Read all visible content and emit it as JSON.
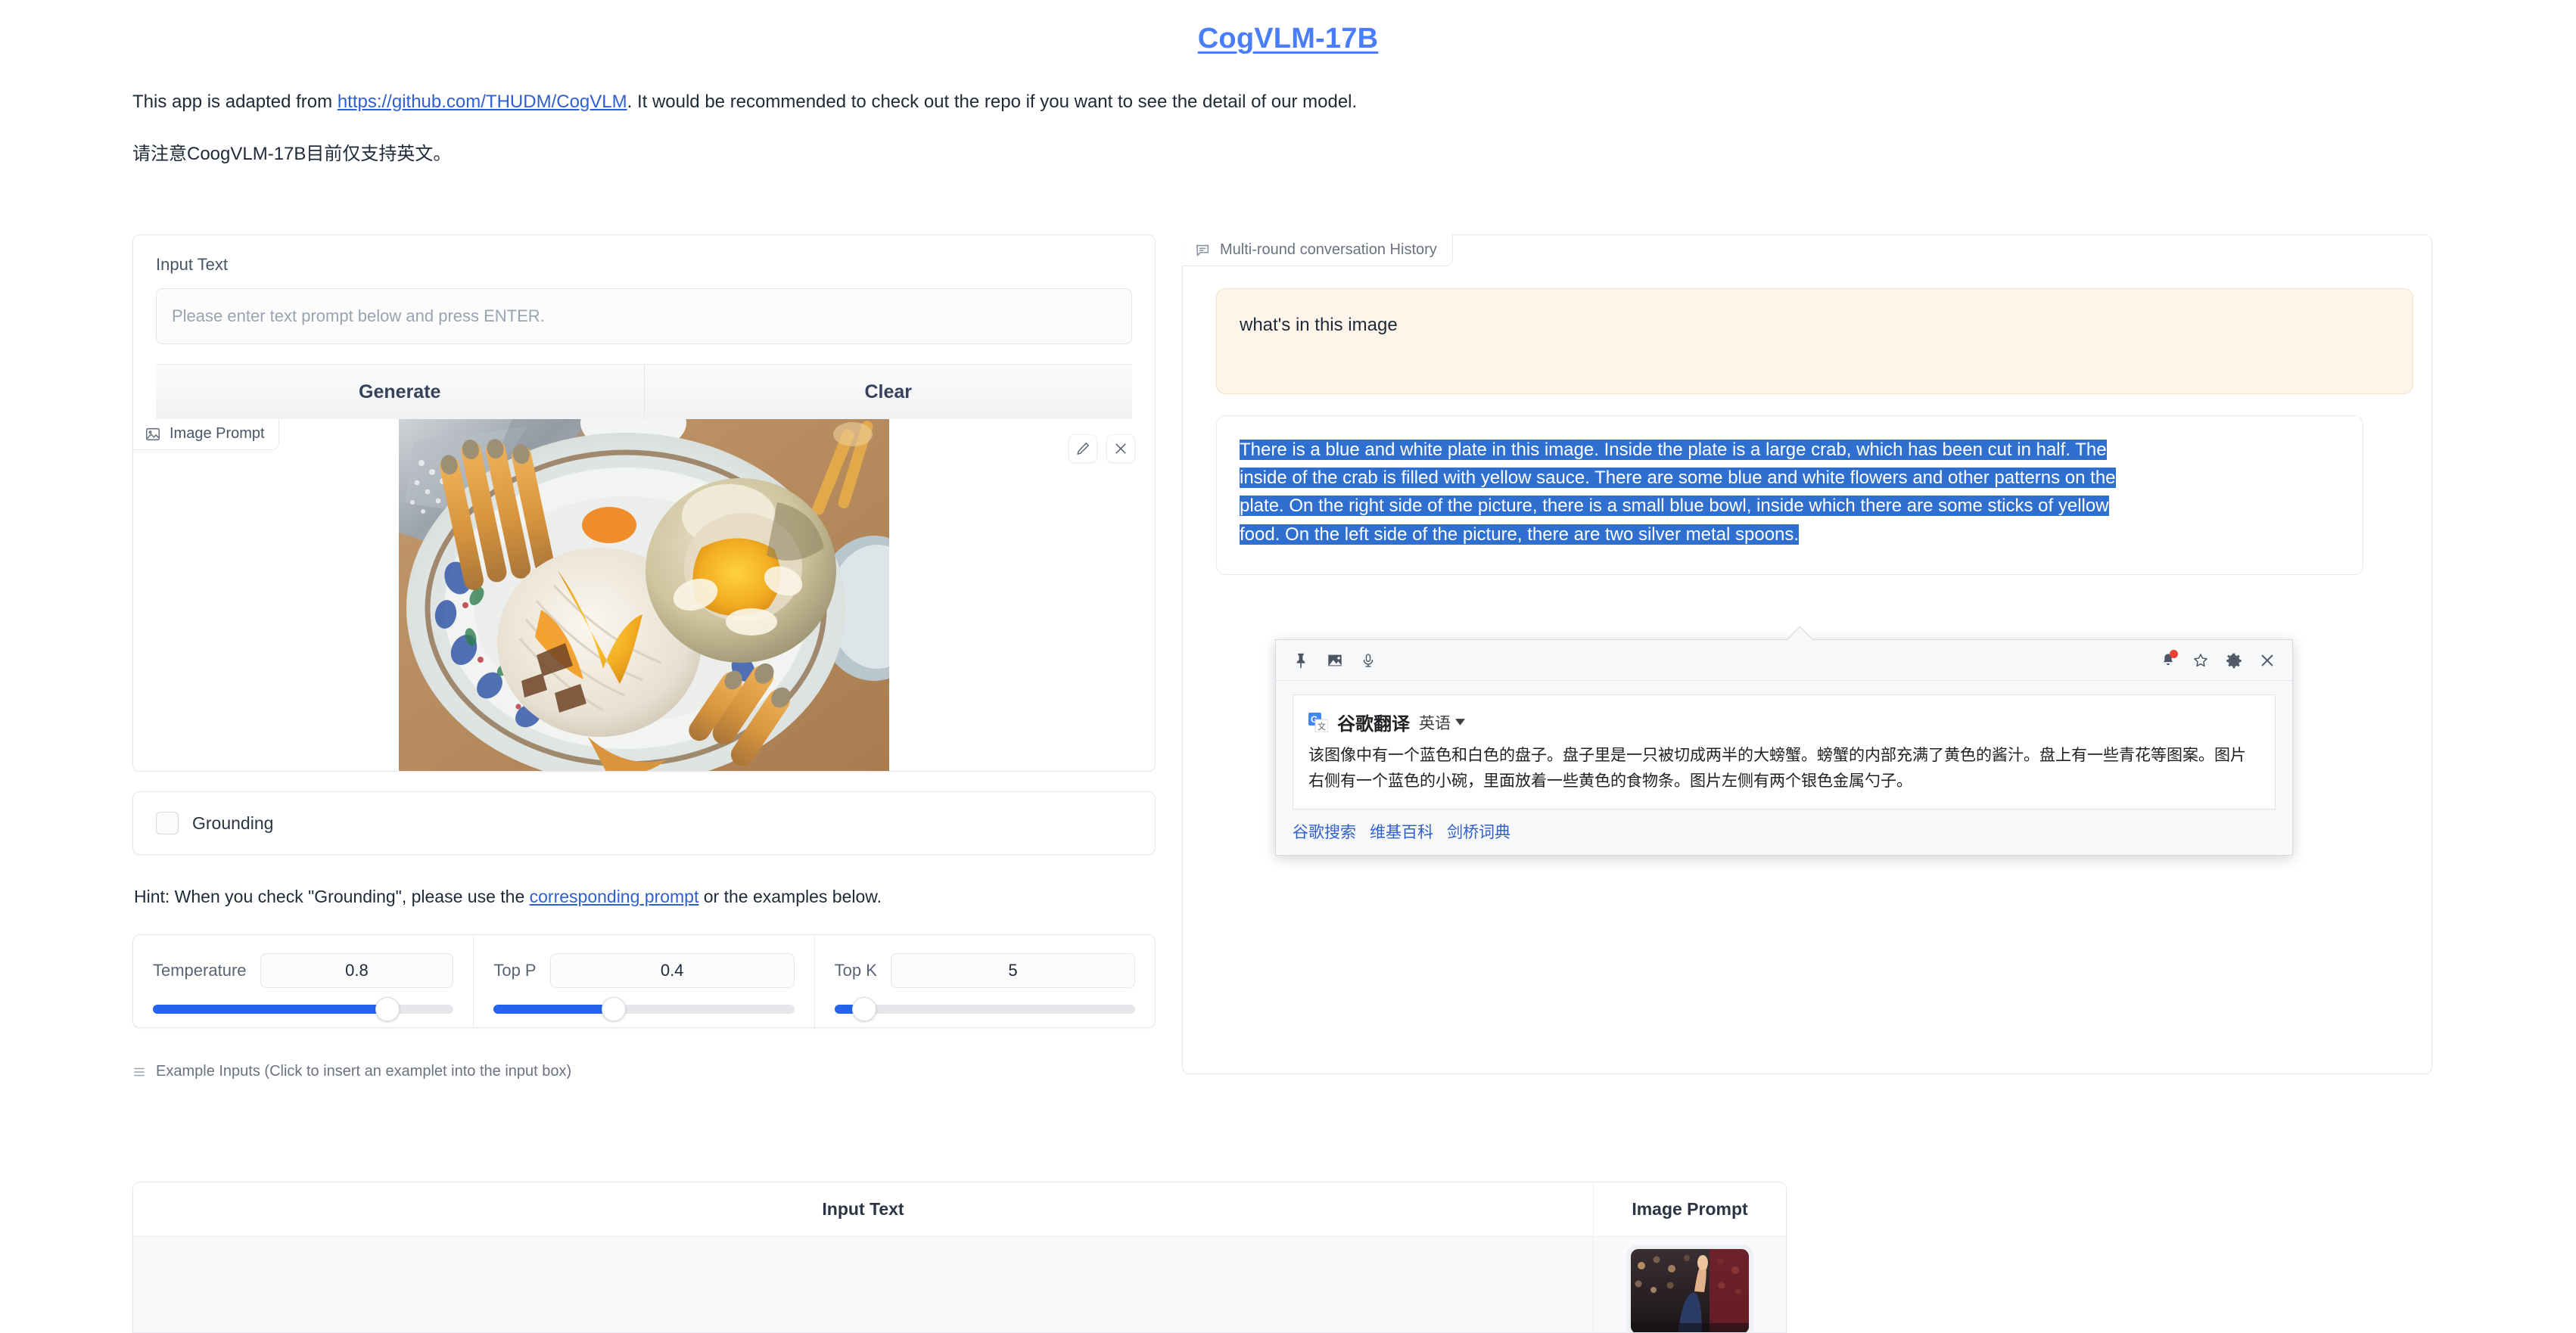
{
  "header": {
    "title": "CogVLM-17B",
    "intro_prefix": "This app is adapted from ",
    "intro_link": "https://github.com/THUDM/CogVLM",
    "intro_suffix": ". It would be recommended to check out the repo if you want to see the detail of our model.",
    "intro_cn": "请注意CoogVLM-17B目前仅支持英文。"
  },
  "left": {
    "input_label": "Input Text",
    "input_value": "",
    "input_placeholder": "Please enter text prompt below and press ENTER.",
    "generate_label": "Generate",
    "clear_label": "Clear",
    "image_prompt_tab": "Image Prompt",
    "edit_icon": "pencil-icon",
    "close_icon": "close-icon",
    "grounding_label": "Grounding",
    "grounding_checked": false,
    "hint_prefix": "Hint: When you check \"Grounding\", please use the ",
    "hint_link": "corresponding prompt",
    "hint_suffix": " or the examples below.",
    "sliders": [
      {
        "name": "Temperature",
        "value": "0.8",
        "percent": 78
      },
      {
        "name": "Top P",
        "value": "0.4",
        "percent": 40
      },
      {
        "name": "Top K",
        "value": "5",
        "percent": 10
      }
    ],
    "examples_header": "Example Inputs (Click to insert an examplet into the input box)",
    "examples_columns": [
      "Input Text",
      "Image Prompt"
    ],
    "examples_rows": [
      {
        "input_text": "",
        "image_prompt": "stadium-crowd-thumbnail"
      }
    ]
  },
  "right": {
    "chat_tab": "Multi-round conversation History",
    "user_message": "what's in this image",
    "bot_message": "There is a blue and white plate in this image. Inside the plate is a large crab, which has been cut in half. The inside of the crab is filled with yellow sauce. There are some blue and white flowers and other patterns on the plate. On the right side of the picture, there is a small blue bowl, inside which there are some sticks of yellow food. On the left side of the picture, there are two silver metal spoons.",
    "bot_message_lines": [
      "There is a blue and white plate in this image. Inside the plate is a large crab, which has been cut in half. The",
      "inside of the crab is filled with yellow sauce. There are some blue and white flowers and other patterns on the",
      "plate. On the right side of the picture, there is a small blue bowl, inside which there are some sticks of yellow",
      "food. On the left side of the picture, there are two silver metal spoons."
    ]
  },
  "translate_popup": {
    "toolbar_left_icons": [
      "pin-icon",
      "image-icon",
      "microphone-icon"
    ],
    "toolbar_right_icons": [
      "bell-icon",
      "star-icon",
      "gear-icon",
      "close-icon"
    ],
    "product_name": "谷歌翻译",
    "language": "英语",
    "translated_text": "该图像中有一个蓝色和白色的盘子。盘子里是一只被切成两半的大螃蟹。螃蟹的内部充满了黄色的酱汁。盘上有一些青花等图案。图片右侧有一个蓝色的小碗，里面放着一些黄色的食物条。图片左侧有两个银色金属勺子。",
    "links": [
      "谷歌搜索",
      "维基百科",
      "剑桥词典"
    ]
  },
  "colors": {
    "accent": "#4a7dfc",
    "link": "#2f5fd0",
    "selection": "#2f6fd0",
    "user_bubble": "#fdf4ea",
    "slider_fill": "#2563eb"
  }
}
